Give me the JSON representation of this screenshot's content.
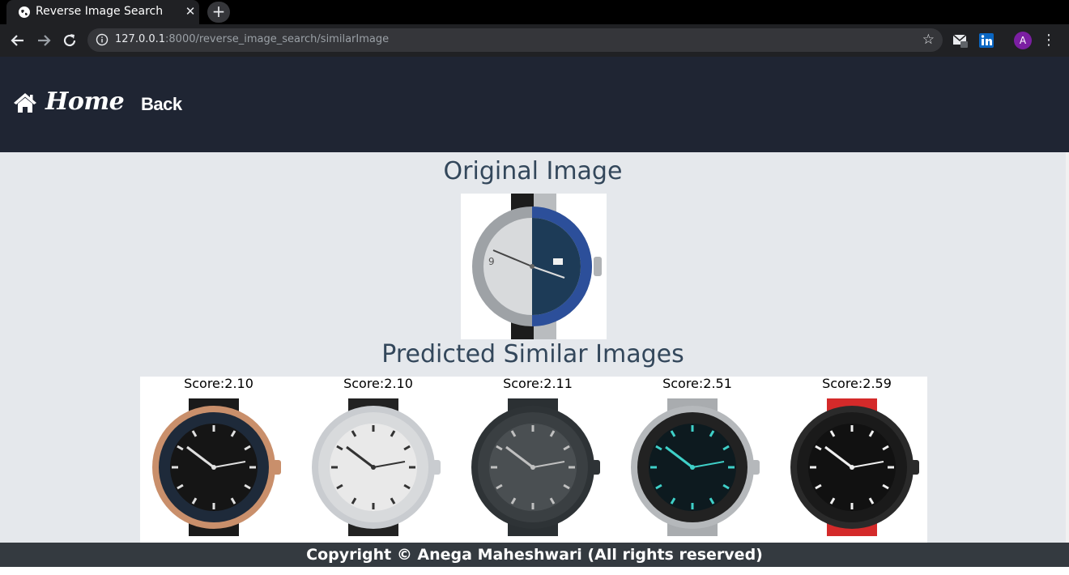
{
  "browser": {
    "tab_title": "Reverse Image Search",
    "close_glyph": "✕",
    "new_tab_glyph": "+",
    "url_host": "127.0.0.1",
    "url_rest": ":8000/reverse_image_search/similarImage",
    "avatar_letter": "A"
  },
  "nav": {
    "home_label": "Home",
    "back_label": "Back"
  },
  "main": {
    "original_heading": "Original Image",
    "predicted_heading": "Predicted Similar Images",
    "results": [
      {
        "score": "Score:2.10",
        "case": "#c98f6b",
        "bezel": "#1e2a3a",
        "dial": "#151515",
        "strap": "#1a1a1a",
        "hands": "#e0e0e0"
      },
      {
        "score": "Score:2.10",
        "case": "#c9ccd0",
        "bezel": "#d8dadc",
        "dial": "#e9e9e9",
        "strap": "#222222",
        "hands": "#333333"
      },
      {
        "score": "Score:2.11",
        "case": "#2e3336",
        "bezel": "#3a3f42",
        "dial": "#4a4f52",
        "strap": "#2b3033",
        "hands": "#c0c0c0"
      },
      {
        "score": "Score:2.51",
        "case": "#b5b8bb",
        "bezel": "#222222",
        "dial": "#0d1a1f",
        "strap": "#a9acaf",
        "hands": "#3fd0c8"
      },
      {
        "score": "Score:2.59",
        "case": "#2a2a2a",
        "bezel": "#1a1a1a",
        "dial": "#111111",
        "strap": "#d42a2a",
        "hands": "#f0f0f0"
      }
    ]
  },
  "footer": {
    "text": "Copyright © Anega Maheshwari (All rights reserved)"
  }
}
